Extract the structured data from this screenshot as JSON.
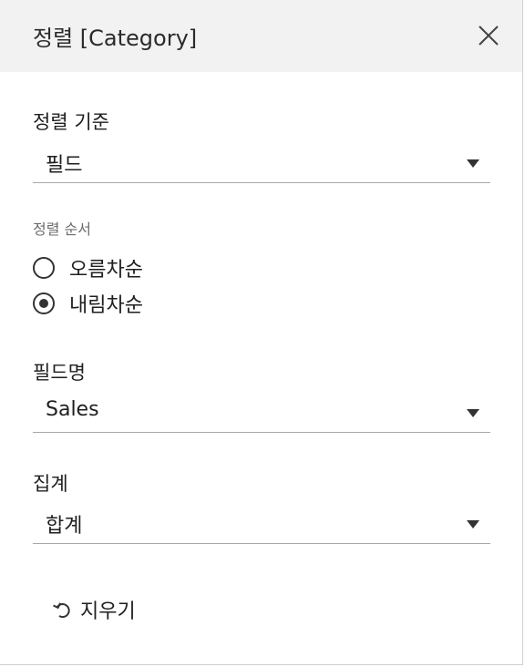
{
  "dialog": {
    "title": "정렬 [Category]",
    "sort_by": {
      "label": "정렬 기준",
      "value": "필드"
    },
    "sort_order": {
      "label": "정렬 순서",
      "options": [
        {
          "label": "오름차순",
          "selected": false
        },
        {
          "label": "내림차순",
          "selected": true
        }
      ]
    },
    "field_name": {
      "label": "필드명",
      "value": "Sales"
    },
    "aggregation": {
      "label": "집계",
      "value": "합계"
    },
    "clear_label": "지우기"
  },
  "icons": {
    "close": "close-icon",
    "dropdown": "dropdown-arrow-icon",
    "reset": "reset-icon"
  }
}
